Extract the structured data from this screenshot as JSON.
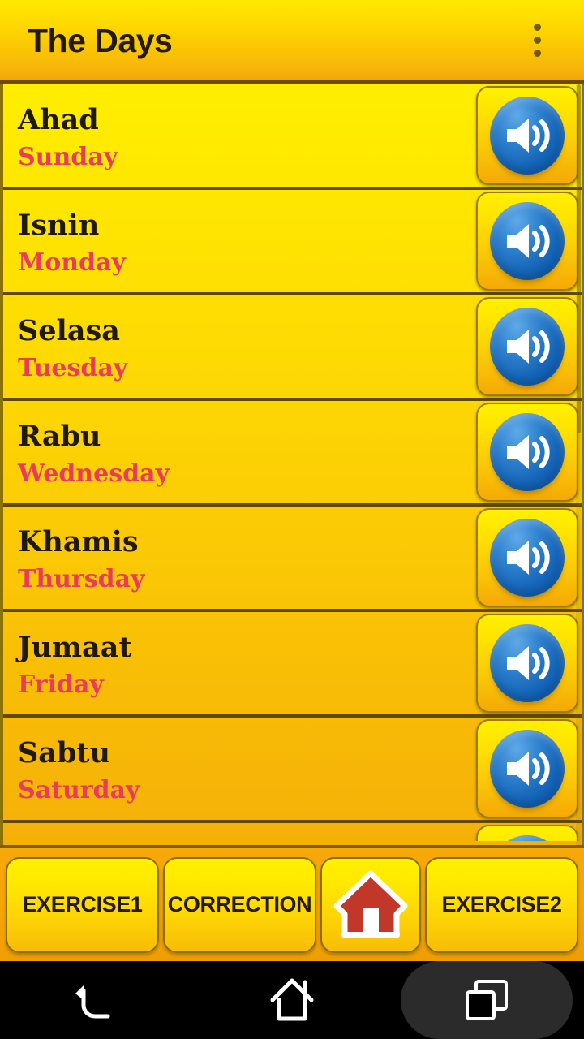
{
  "header": {
    "title": "The Days",
    "overflow_icon": "more-vert-icon"
  },
  "list": {
    "play_icon": "speaker-volume-icon",
    "rows": [
      {
        "term": "Ahad",
        "translation": "Sunday"
      },
      {
        "term": "Isnin",
        "translation": "Monday"
      },
      {
        "term": "Selasa",
        "translation": "Tuesday"
      },
      {
        "term": "Rabu",
        "translation": "Wednesday"
      },
      {
        "term": "Khamis",
        "translation": "Thursday"
      },
      {
        "term": "Jumaat",
        "translation": "Friday"
      },
      {
        "term": "Sabtu",
        "translation": "Saturday"
      }
    ]
  },
  "bottom_bar": {
    "buttons": [
      {
        "label": "EXERCISE1",
        "icon": ""
      },
      {
        "label": "CORRECTION",
        "icon": ""
      },
      {
        "label": "",
        "icon": "home-house-icon"
      },
      {
        "label": "EXERCISE2",
        "icon": ""
      }
    ]
  },
  "android_nav": {
    "back_icon": "back-arrow-icon",
    "home_icon": "home-outline-icon",
    "recents_icon": "recents-squares-icon"
  },
  "colors": {
    "header_top": "#FFE800",
    "header_bottom": "#F2A608",
    "list_top": "#FFEE00",
    "list_bottom": "#F5B008",
    "term_text": "#1F1A0B",
    "translation_text": "#EA3A5E",
    "divider": "#5E4A06",
    "speaker_blue": "#1565B8",
    "bottom_bar_bg": "#F5A406",
    "home_red": "#C1372A",
    "nav_bar_bg": "#000000"
  }
}
